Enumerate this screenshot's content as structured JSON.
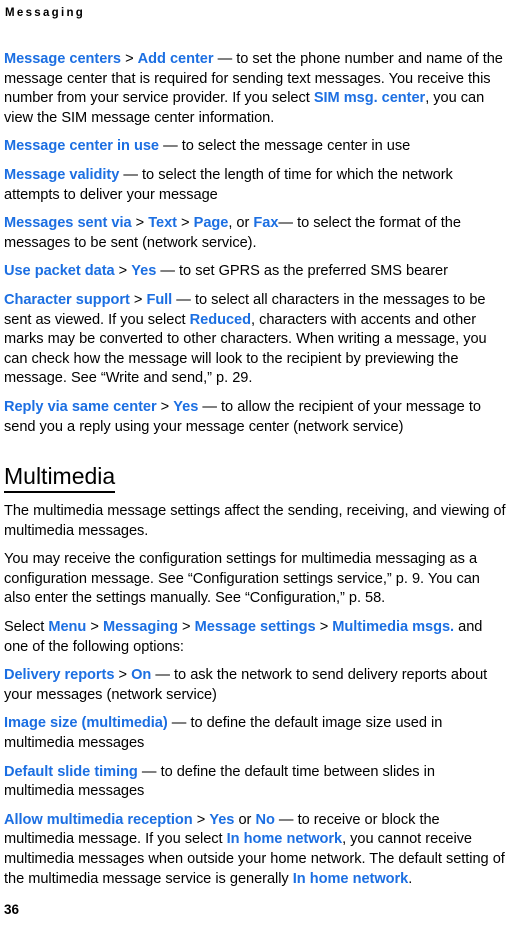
{
  "colors": {
    "accent_blue": "#1C6FE2",
    "text_black": "#000000",
    "page_background": "#FFFFFF"
  },
  "header": {
    "running_title": "Messaging"
  },
  "footer": {
    "page_number": "36"
  },
  "content": {
    "sms_settings": {
      "entries": [
        {
          "id": "message-centers",
          "terms": [
            "Message centers",
            "Add center",
            "SIM msg. center"
          ],
          "segments": [
            {
              "style": "ui",
              "text": "Message centers"
            },
            {
              "style": "text",
              "text": " > "
            },
            {
              "style": "ui",
              "text": "Add center"
            },
            {
              "style": "text",
              "text": " — to set the phone number and name of the message center that is required for sending text messages. You receive this number from your service provider. If you select "
            },
            {
              "style": "ui",
              "text": "SIM msg. center"
            },
            {
              "style": "text",
              "text": ", you can view the SIM message center information."
            }
          ]
        },
        {
          "id": "message-center-in-use",
          "terms": [
            "Message center in use"
          ],
          "segments": [
            {
              "style": "ui",
              "text": "Message center in use"
            },
            {
              "style": "text",
              "text": " — to select the message center in use"
            }
          ]
        },
        {
          "id": "message-validity",
          "terms": [
            "Message validity"
          ],
          "segments": [
            {
              "style": "ui",
              "text": "Message validity"
            },
            {
              "style": "text",
              "text": " — to select the length of time for which the network attempts to deliver your message"
            }
          ]
        },
        {
          "id": "messages-sent-via",
          "terms": [
            "Messages sent via",
            "Text",
            "Page",
            "Fax"
          ],
          "segments": [
            {
              "style": "ui",
              "text": "Messages sent via"
            },
            {
              "style": "text",
              "text": " > "
            },
            {
              "style": "ui",
              "text": "Text"
            },
            {
              "style": "text",
              "text": " > "
            },
            {
              "style": "ui",
              "text": "Page"
            },
            {
              "style": "text",
              "text": ", or "
            },
            {
              "style": "ui",
              "text": "Fax"
            },
            {
              "style": "text",
              "text": "— to select the format of the messages to be sent (network service)."
            }
          ]
        },
        {
          "id": "use-packet-data",
          "terms": [
            "Use packet data",
            "Yes"
          ],
          "segments": [
            {
              "style": "ui",
              "text": "Use packet data"
            },
            {
              "style": "text",
              "text": " > "
            },
            {
              "style": "ui",
              "text": "Yes"
            },
            {
              "style": "text",
              "text": " — to set GPRS as the preferred SMS bearer"
            }
          ]
        },
        {
          "id": "character-support",
          "terms": [
            "Character support",
            "Full",
            "Reduced"
          ],
          "segments": [
            {
              "style": "ui",
              "text": "Character support"
            },
            {
              "style": "text",
              "text": " > "
            },
            {
              "style": "ui",
              "text": "Full"
            },
            {
              "style": "text",
              "text": " — to select all characters in the messages to be sent as viewed. If you select "
            },
            {
              "style": "ui",
              "text": "Reduced"
            },
            {
              "style": "text",
              "text": ", characters with accents and other marks may be converted to other characters. When writing a message, you can check how the message will look to the recipient by previewing the message. See “Write and send,” p. 29."
            }
          ]
        },
        {
          "id": "reply-via-same-center",
          "terms": [
            "Reply via same center",
            "Yes"
          ],
          "segments": [
            {
              "style": "ui",
              "text": "Reply via same center"
            },
            {
              "style": "text",
              "text": " > "
            },
            {
              "style": "ui",
              "text": "Yes"
            },
            {
              "style": "text",
              "text": " — to allow the recipient of your message to send you a reply using your message center (network service)"
            }
          ]
        }
      ]
    },
    "multimedia_section": {
      "heading": "Multimedia",
      "intro_paragraphs": [
        {
          "id": "multimedia-intro-1",
          "segments": [
            {
              "style": "text",
              "text": "The multimedia message settings affect the sending, receiving, and viewing of multimedia messages."
            }
          ]
        },
        {
          "id": "multimedia-intro-2",
          "segments": [
            {
              "style": "text",
              "text": "You may receive the configuration settings for multimedia messaging as a configuration message. See “Configuration settings service,” p. 9. You can also enter the settings manually. See “Configuration,” p. 58."
            }
          ]
        },
        {
          "id": "multimedia-menu-path",
          "terms": [
            "Menu",
            "Messaging",
            "Message settings",
            "Multimedia msgs."
          ],
          "segments": [
            {
              "style": "text",
              "text": "Select "
            },
            {
              "style": "ui",
              "text": "Menu"
            },
            {
              "style": "text",
              "text": " > "
            },
            {
              "style": "ui",
              "text": "Messaging"
            },
            {
              "style": "text",
              "text": " > "
            },
            {
              "style": "ui",
              "text": "Message settings"
            },
            {
              "style": "text",
              "text": " > "
            },
            {
              "style": "ui",
              "text": "Multimedia msgs."
            },
            {
              "style": "text",
              "text": " and one of the following options:"
            }
          ]
        }
      ],
      "entries": [
        {
          "id": "delivery-reports",
          "terms": [
            "Delivery reports",
            "On"
          ],
          "segments": [
            {
              "style": "ui",
              "text": "Delivery reports"
            },
            {
              "style": "text",
              "text": " > "
            },
            {
              "style": "ui",
              "text": "On"
            },
            {
              "style": "text",
              "text": " — to ask the network to send delivery reports about your messages (network service)"
            }
          ]
        },
        {
          "id": "image-size-multimedia",
          "terms": [
            "Image size (multimedia)"
          ],
          "segments": [
            {
              "style": "ui",
              "text": "Image size (multimedia)"
            },
            {
              "style": "text",
              "text": " — to define the default image size used in multimedia messages"
            }
          ]
        },
        {
          "id": "default-slide-timing",
          "terms": [
            "Default slide timing"
          ],
          "segments": [
            {
              "style": "ui",
              "text": "Default slide timing"
            },
            {
              "style": "text",
              "text": " — to define the default time between slides in multimedia messages"
            }
          ]
        },
        {
          "id": "allow-multimedia-reception",
          "terms": [
            "Allow multimedia reception",
            "Yes",
            "No",
            "In home network"
          ],
          "segments": [
            {
              "style": "ui",
              "text": "Allow multimedia reception"
            },
            {
              "style": "text",
              "text": " > "
            },
            {
              "style": "ui",
              "text": "Yes"
            },
            {
              "style": "text",
              "text": " or "
            },
            {
              "style": "ui",
              "text": "No"
            },
            {
              "style": "text",
              "text": " — to receive or block the multimedia message. If you select "
            },
            {
              "style": "ui",
              "text": "In home network"
            },
            {
              "style": "text",
              "text": ", you cannot receive multimedia messages when outside your home network. The default setting of the multimedia message service is generally "
            },
            {
              "style": "ui",
              "text": "In home network"
            },
            {
              "style": "text",
              "text": "."
            }
          ]
        }
      ]
    }
  }
}
